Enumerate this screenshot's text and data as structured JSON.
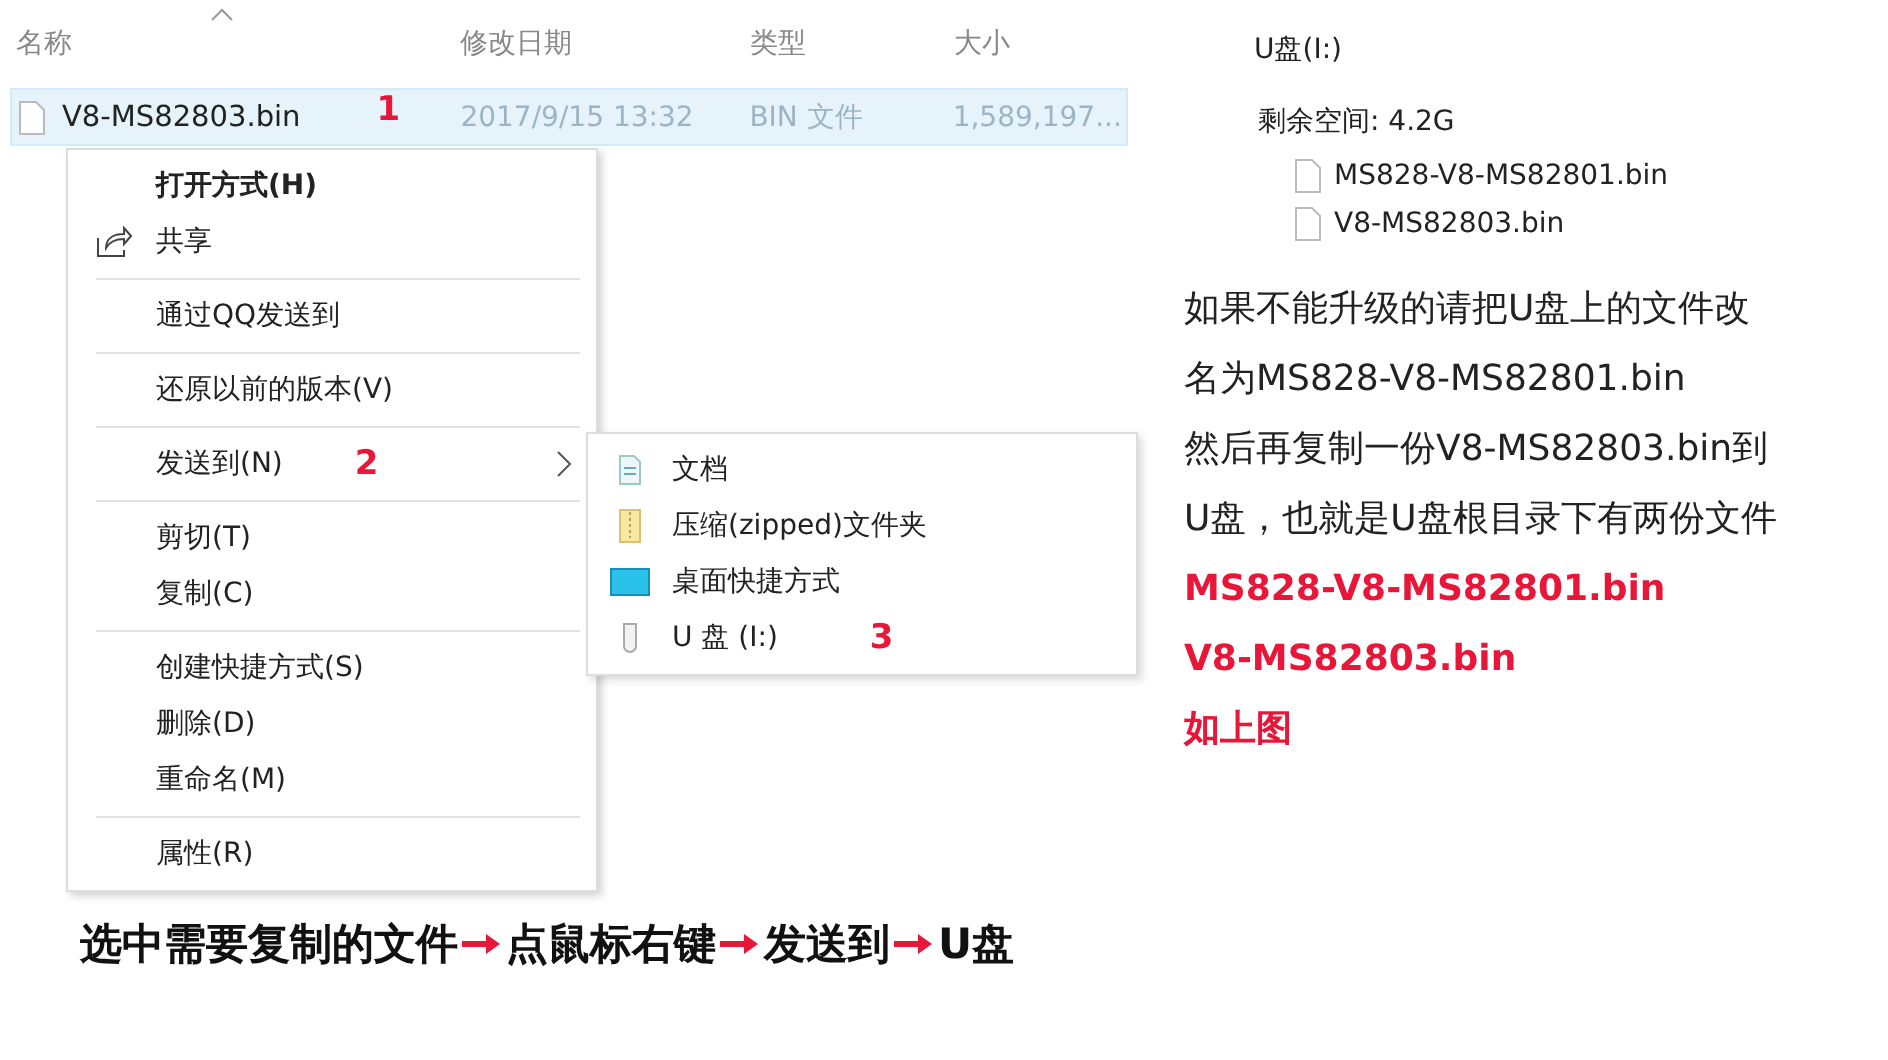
{
  "file_list": {
    "columns": [
      "名称",
      "修改日期",
      "类型",
      "大小"
    ],
    "rows": [
      {
        "name": "V8-MS82803.bin",
        "date": "2017/9/15 13:32",
        "type": "BIN 文件",
        "size": "1,589,197...",
        "selected": true,
        "marker": "1"
      }
    ]
  },
  "context_menu": {
    "groups": [
      [
        {
          "label": "打开方式(H)",
          "kind": "plain",
          "bold": true
        },
        {
          "label": "共享",
          "kind": "share",
          "bold": false
        }
      ],
      [
        {
          "label": "通过QQ发送到",
          "kind": "plain",
          "bold": false
        }
      ],
      [
        {
          "label": "还原以前的版本(V)",
          "kind": "plain",
          "bold": false
        }
      ],
      [
        {
          "label": "发送到(N)",
          "kind": "submenu",
          "bold": false,
          "marker": "2",
          "expanded": true
        }
      ],
      [
        {
          "label": "剪切(T)",
          "kind": "plain",
          "bold": false
        },
        {
          "label": "复制(C)",
          "kind": "plain",
          "bold": false
        }
      ],
      [
        {
          "label": "创建快捷方式(S)",
          "kind": "plain",
          "bold": false
        },
        {
          "label": "删除(D)",
          "kind": "plain",
          "bold": false
        },
        {
          "label": "重命名(M)",
          "kind": "plain",
          "bold": false
        }
      ],
      [
        {
          "label": "属性(R)",
          "kind": "plain",
          "bold": false
        }
      ]
    ]
  },
  "submenu": {
    "items": [
      {
        "label": "文档",
        "kind": "document"
      },
      {
        "label": "压缩(zipped)文件夹",
        "kind": "zip"
      },
      {
        "label": "桌面快捷方式",
        "kind": "desktop"
      },
      {
        "label": "U 盘 (I:)",
        "kind": "usb",
        "marker": "3"
      }
    ]
  },
  "drive_panel": {
    "title": "U盘(I:)",
    "free_space": "剩余空间: 4.2G",
    "files": [
      "MS828-V8-MS82801.bin",
      "V8-MS82803.bin"
    ]
  },
  "instructions": {
    "lines": [
      {
        "text": "如果不能升级的请把U盘上的文件改",
        "highlight": false
      },
      {
        "text": "名为MS828-V8-MS82801.bin",
        "highlight": false
      },
      {
        "text": "然后再复制一份V8-MS82803.bin到",
        "highlight": false
      },
      {
        "text": "U盘，也就是U盘根目录下有两份文件",
        "highlight": false
      },
      {
        "text": "MS828-V8-MS82801.bin",
        "highlight": true
      },
      {
        "text": "V8-MS82803.bin",
        "highlight": true
      },
      {
        "text": "如上图",
        "highlight": true
      }
    ]
  },
  "caption": {
    "steps": [
      "选中需要复制的文件",
      "点鼠标右键",
      "发送到",
      "U盘"
    ]
  }
}
